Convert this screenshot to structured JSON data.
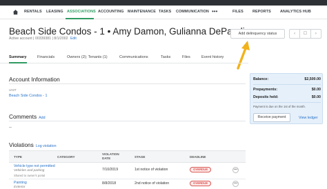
{
  "nav": {
    "items": [
      "RENTALS",
      "LEASING",
      "ASSOCIATIONS",
      "ACCOUNTING",
      "MAINTENANCE",
      "TASKS",
      "COMMUNICATION"
    ],
    "right_items": [
      "FILES",
      "REPORTS",
      "ANALYTICS HUB"
    ],
    "active": "ASSOCIATIONS",
    "more": "•••"
  },
  "header": {
    "title": "Beach Side Condos - 1 • Amy Damon, Gulianna DePandi",
    "subtitle": "Active account | 00339381 | 8/1/2002",
    "edit": "Edit",
    "delinquency_button": "Add delinquency status",
    "pager_prev": "‹",
    "pager_mid": "☐",
    "pager_next": "›"
  },
  "tabs": [
    "Summary",
    "Financials",
    "Owners (2); Tenants (1)",
    "Communications",
    "Tasks",
    "Files",
    "Event history"
  ],
  "account_info": {
    "title": "Account Information",
    "unit_label": "UNIT",
    "unit_value": "Beach Side Condos - 1"
  },
  "comments": {
    "title": "Comments",
    "add": "Add",
    "empty": "--"
  },
  "violations": {
    "title": "Violations",
    "log": "Log violation",
    "columns": {
      "type": "TYPE",
      "category": "CATEGORY",
      "violation_date_1": "VIOLATION",
      "violation_date_2": "DATE",
      "stage": "STAGE",
      "deadline": "DEADLINE"
    },
    "rows": [
      {
        "type": "Vehicle type not permitted",
        "category_line": "Vehicles and parking",
        "sub_note": "Shared to owner's portal",
        "date": "7/10/2019",
        "stage": "1st notice of violation",
        "deadline": "OVERDUE",
        "menu": "•••"
      },
      {
        "type": "Painting",
        "category_line": "Exterior",
        "sub_note": "",
        "date": "8/8/2018",
        "stage": "2nd notice of violation",
        "deadline": "OVERDUE",
        "menu": "•••"
      }
    ]
  },
  "balance_card": {
    "balance_label": "Balance:",
    "balance_value": "$2,500.00",
    "prepayments_label": "Prepayments:",
    "prepayments_value": "$0.00",
    "deposits_label": "Deposits held:",
    "deposits_value": "$0.00",
    "note": "Payment is due on the 1st of the month.",
    "receive_payment": "Receive payment",
    "view_ledger": "View ledger"
  },
  "colors": {
    "accent": "#2f9a61",
    "link": "#2b74c9",
    "overdue": "#d9534f",
    "card_bg": "#e6f0fa",
    "arrow": "#f2b21b"
  }
}
